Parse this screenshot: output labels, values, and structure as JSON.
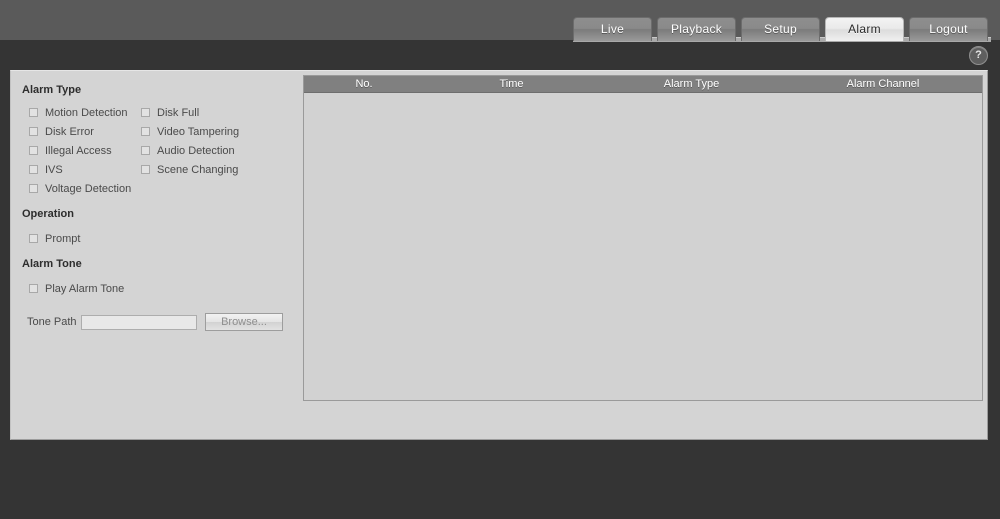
{
  "nav": {
    "tabs": [
      {
        "label": "Live",
        "active": false
      },
      {
        "label": "Playback",
        "active": false
      },
      {
        "label": "Setup",
        "active": false
      },
      {
        "label": "Alarm",
        "active": true
      },
      {
        "label": "Logout",
        "active": false
      }
    ]
  },
  "help": {
    "icon": "help-circle-icon",
    "glyph": "?"
  },
  "alarm_type": {
    "title": "Alarm Type",
    "column1": [
      {
        "label": "Motion Detection",
        "checked": false
      },
      {
        "label": "Disk Error",
        "checked": false
      },
      {
        "label": "Illegal Access",
        "checked": false
      },
      {
        "label": "IVS",
        "checked": false
      },
      {
        "label": "Voltage Detection",
        "checked": false
      }
    ],
    "column2": [
      {
        "label": "Disk Full",
        "checked": false
      },
      {
        "label": "Video Tampering",
        "checked": false
      },
      {
        "label": "Audio Detection",
        "checked": false
      },
      {
        "label": "Scene Changing",
        "checked": false
      }
    ]
  },
  "operation": {
    "title": "Operation",
    "items": [
      {
        "label": "Prompt",
        "checked": false
      }
    ]
  },
  "alarm_tone": {
    "title": "Alarm Tone",
    "items": [
      {
        "label": "Play Alarm Tone",
        "checked": false
      }
    ],
    "tone_path_label": "Tone Path",
    "tone_path_value": "",
    "tone_path_placeholder": "",
    "browse_label": "Browse..."
  },
  "alarm_table": {
    "columns": [
      {
        "key": "no",
        "label": "No."
      },
      {
        "key": "time",
        "label": "Time"
      },
      {
        "key": "type",
        "label": "Alarm Type"
      },
      {
        "key": "channel",
        "label": "Alarm Channel"
      }
    ],
    "rows": []
  },
  "colors": {
    "page_background": "#343434",
    "top_bar": "#5a5a5a",
    "panel": "#d4d4d4",
    "table_header": "#808080",
    "table_body": "#d2d2d2",
    "active_tab_text": "#2b2b2b",
    "tab_text": "#ffffff"
  }
}
